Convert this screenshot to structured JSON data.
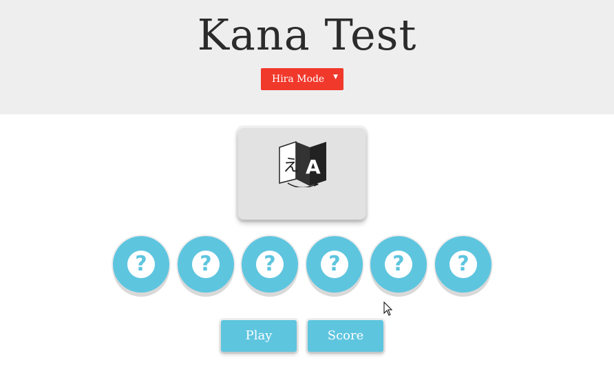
{
  "header": {
    "title": "Kana Test",
    "mode_select": {
      "selected": "Hira Mode",
      "arrow_icon": "triangle-down"
    }
  },
  "card": {
    "icon": "translate-kana-to-latin-icon"
  },
  "answer_bubbles": [
    {
      "symbol": "?"
    },
    {
      "symbol": "?"
    },
    {
      "symbol": "?"
    },
    {
      "symbol": "?"
    },
    {
      "symbol": "?"
    },
    {
      "symbol": "?"
    }
  ],
  "buttons": {
    "play_label": "Play",
    "score_label": "Score"
  },
  "colors": {
    "header_bg": "#eeeeee",
    "select_red": "#f0382b",
    "accent_blue": "#5ec5df",
    "card_bg": "#e2e2e2",
    "title_text": "#2b2b2b"
  }
}
